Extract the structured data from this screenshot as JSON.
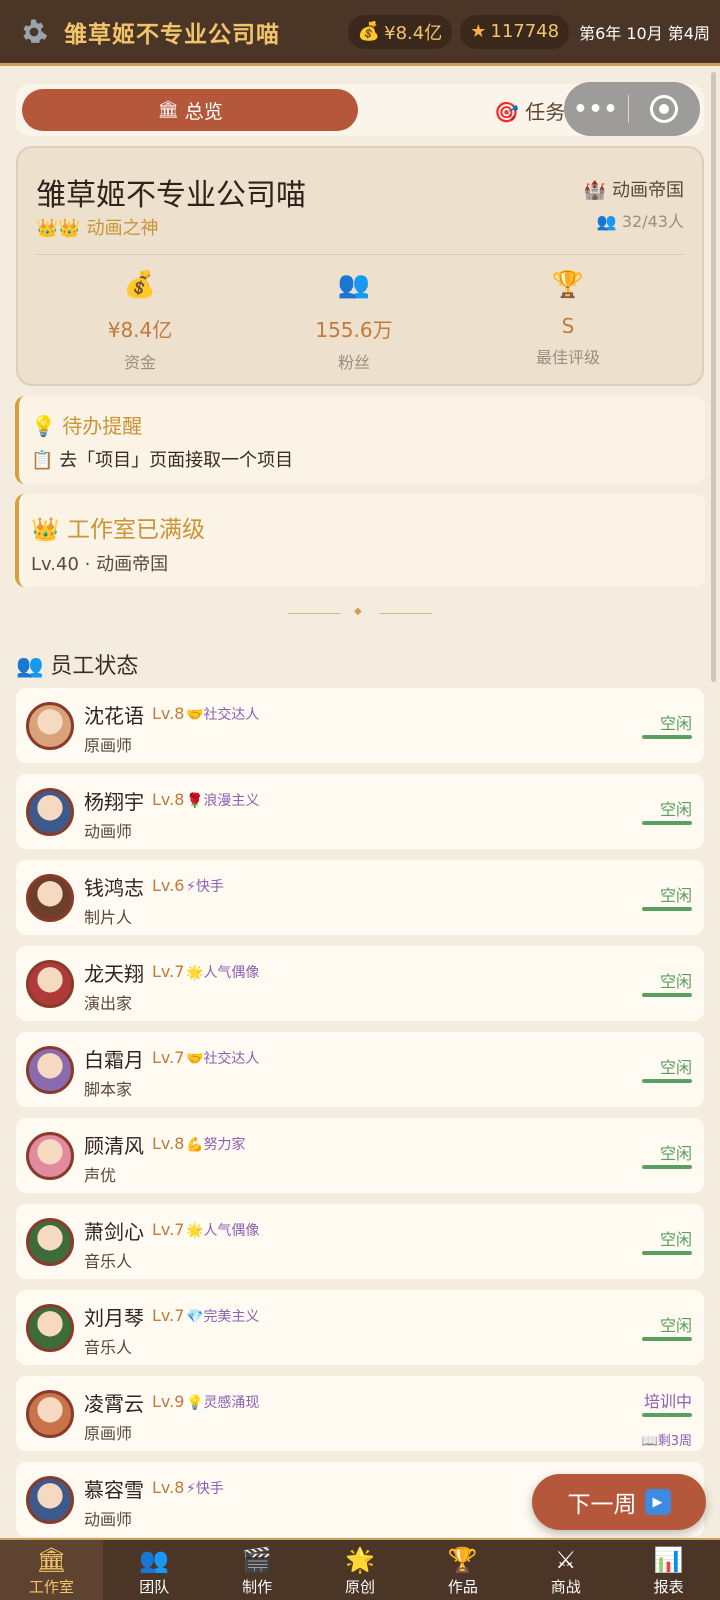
{
  "header": {
    "company_name": "雏草姬不专业公司喵",
    "money": "¥8.4亿",
    "stars": "117748",
    "date": "第6年 10月 第4周"
  },
  "tabs": {
    "active_label": "总览",
    "second_label": "任务"
  },
  "company": {
    "name": "雏草姬不专业公司喵",
    "rank": "动画之神",
    "level_title": "动画帝国",
    "staff": "32/43人",
    "stats": [
      {
        "icon": "money-bag-icon",
        "value": "¥8.4亿",
        "label": "资金"
      },
      {
        "icon": "fans-icon",
        "value": "155.6万",
        "label": "粉丝"
      },
      {
        "icon": "trophy-icon",
        "value": "S",
        "label": "最佳评级"
      }
    ]
  },
  "todo": {
    "title": "待办提醒",
    "text": "去「项目」页面接取一个项目"
  },
  "studio": {
    "title": "工作室已满级",
    "text": "Lv.40 · 动画帝国"
  },
  "employees_title": "员工状态",
  "employees": [
    {
      "name": "沈花语",
      "level": "Lv.8",
      "trait_icon": "handshake-icon",
      "trait": "社交达人",
      "role": "原画师",
      "status": "空闲",
      "progress": 1.0
    },
    {
      "name": "杨翔宇",
      "level": "Lv.8",
      "trait_icon": "rose-icon",
      "trait": "浪漫主义",
      "role": "动画师",
      "status": "空闲",
      "progress": 1.0
    },
    {
      "name": "钱鸿志",
      "level": "Lv.6",
      "trait_icon": "lightning-icon",
      "trait": "快手",
      "role": "制片人",
      "status": "空闲",
      "progress": 1.0
    },
    {
      "name": "龙天翔",
      "level": "Lv.7",
      "trait_icon": "star-burst-icon",
      "trait": "人气偶像",
      "role": "演出家",
      "status": "空闲",
      "progress": 1.0
    },
    {
      "name": "白霜月",
      "level": "Lv.7",
      "trait_icon": "handshake-icon",
      "trait": "社交达人",
      "role": "脚本家",
      "status": "空闲",
      "progress": 1.0
    },
    {
      "name": "顾清风",
      "level": "Lv.8",
      "trait_icon": "muscle-icon",
      "trait": "努力家",
      "role": "声优",
      "status": "空闲",
      "progress": 1.0
    },
    {
      "name": "萧剑心",
      "level": "Lv.7",
      "trait_icon": "star-burst-icon",
      "trait": "人气偶像",
      "role": "音乐人",
      "status": "空闲",
      "progress": 1.0
    },
    {
      "name": "刘月琴",
      "level": "Lv.7",
      "trait_icon": "diamond-icon",
      "trait": "完美主义",
      "role": "音乐人",
      "status": "空闲",
      "progress": 1.0
    },
    {
      "name": "凌霄云",
      "level": "Lv.9",
      "trait_icon": "lightbulb-icon",
      "trait": "灵感涌现",
      "role": "原画师",
      "status": "培训中",
      "progress": 1.0,
      "remaining": "剩3周"
    },
    {
      "name": "慕容雪",
      "level": "Lv.8",
      "trait_icon": "lightning-icon",
      "trait": "快手",
      "role": "动画师",
      "status": "",
      "progress": 0
    }
  ],
  "next_week_label": "下一周",
  "nav": [
    {
      "label": "工作室",
      "icon": "studio-icon",
      "active": true
    },
    {
      "label": "团队",
      "icon": "team-icon"
    },
    {
      "label": "制作",
      "icon": "clapper-icon"
    },
    {
      "label": "原创",
      "icon": "spark-icon"
    },
    {
      "label": "作品",
      "icon": "trophy-icon"
    },
    {
      "label": "商战",
      "icon": "swords-icon"
    },
    {
      "label": "报表",
      "icon": "chart-icon"
    }
  ],
  "colors": {
    "brand_brown": "#4a3526",
    "accent_gold": "#f2c46a",
    "active_tab": "#b5573a",
    "idle_green": "#5a9e60",
    "trait_purple": "#8b5fb3"
  }
}
